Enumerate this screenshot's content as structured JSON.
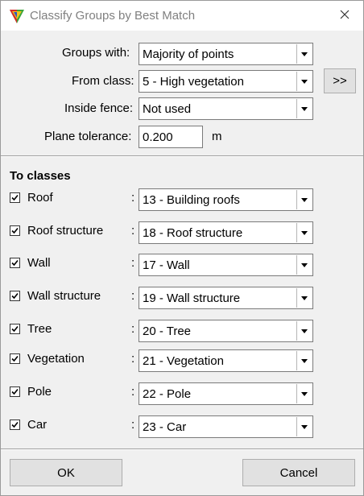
{
  "window": {
    "title": "Classify Groups by Best Match"
  },
  "icons": {
    "app": "app-logo-icon",
    "close": "close-icon",
    "dropdown": "chevron-down-icon",
    "check": "checkmark-icon"
  },
  "settings": {
    "groups_with": {
      "label": "Groups with:",
      "value": "Majority of points"
    },
    "from_class": {
      "label": "From class:",
      "value": "5 - High vegetation"
    },
    "more_button": ">>",
    "inside_fence": {
      "label": "Inside fence:",
      "value": "Not used"
    },
    "plane_tolerance": {
      "label": "Plane tolerance:",
      "value": "0.200",
      "unit": "m"
    }
  },
  "to_classes": {
    "heading": "To classes",
    "rows": [
      {
        "checked": true,
        "label": "Roof",
        "colon": ":",
        "value": "13 - Building roofs"
      },
      {
        "checked": true,
        "label": "Roof structure",
        "colon": ":",
        "value": "18 - Roof structure"
      },
      {
        "checked": true,
        "label": "Wall",
        "colon": ":",
        "value": "17 - Wall"
      },
      {
        "checked": true,
        "label": "Wall structure",
        "colon": ":",
        "value": "19 - Wall structure"
      },
      {
        "checked": true,
        "label": "Tree",
        "colon": ":",
        "value": "20 - Tree"
      },
      {
        "checked": true,
        "label": "Vegetation",
        "colon": ":",
        "value": "21 - Vegetation"
      },
      {
        "checked": true,
        "label": "Pole",
        "colon": ":",
        "value": "22 - Pole"
      },
      {
        "checked": true,
        "label": "Car",
        "colon": ":",
        "value": "23 - Car"
      }
    ]
  },
  "buttons": {
    "ok": "OK",
    "cancel": "Cancel"
  }
}
